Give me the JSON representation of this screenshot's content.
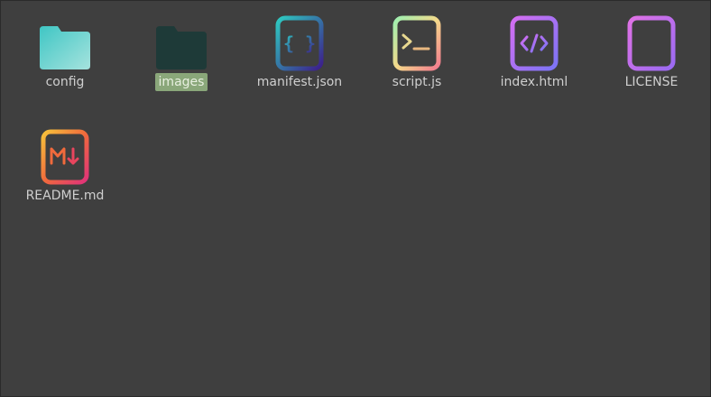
{
  "items": [
    {
      "label": "config",
      "type": "folder-icon"
    },
    {
      "label": "images",
      "type": "folder-icon",
      "selected": true
    },
    {
      "label": "manifest.json",
      "type": "json-file-icon"
    },
    {
      "label": "script.js",
      "type": "terminal-file-icon"
    },
    {
      "label": "index.html",
      "type": "html-file-icon"
    },
    {
      "label": "LICENSE",
      "type": "text-file-icon"
    },
    {
      "label": "README.md",
      "type": "markdown-file-icon"
    }
  ]
}
